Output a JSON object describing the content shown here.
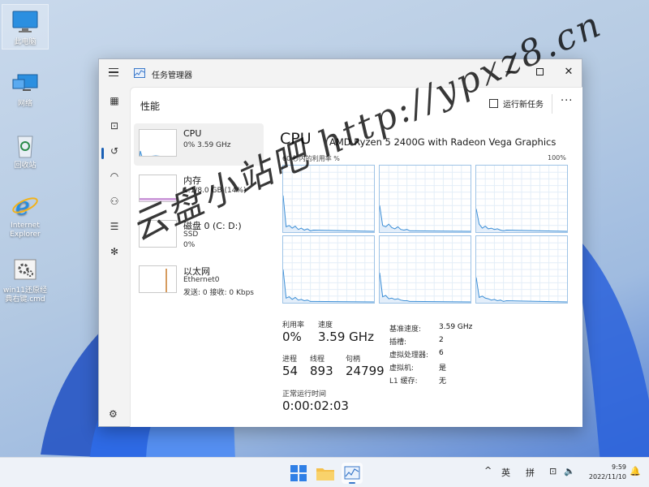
{
  "desktop": {
    "icons": [
      {
        "label": "此电脑"
      },
      {
        "label": "网络"
      },
      {
        "label": "回收站"
      },
      {
        "label": "Internet Explorer"
      },
      {
        "label": "win11还原经典右键.cmd"
      }
    ]
  },
  "window": {
    "title": "任务管理器",
    "page_title": "性能",
    "run_new_task": "运行新任务",
    "more": "···"
  },
  "resources": [
    {
      "name": "CPU",
      "line1": "0% 3.59 GHz",
      "line2": ""
    },
    {
      "name": "内存",
      "line1": "1.1/8.0 GB (14%)",
      "line2": ""
    },
    {
      "name": "磁盘 0 (C: D:)",
      "line1": "SSD",
      "line2": "0%"
    },
    {
      "name": "以太网",
      "line1": "Ethernet0",
      "line2": "发送: 0 接收: 0 Kbps"
    }
  ],
  "cpu": {
    "title": "CPU",
    "model": "AMD Ryzen 5 2400G with Radeon Vega Graphics",
    "graph_label": "60 秒内的利用率 %",
    "graph_max": "100%",
    "stats": {
      "utilization_label": "利用率",
      "utilization": "0%",
      "speed_label": "速度",
      "speed": "3.59 GHz",
      "processes_label": "进程",
      "processes": "54",
      "threads_label": "线程",
      "threads": "893",
      "handles_label": "句柄",
      "handles": "24799",
      "uptime_label": "正常运行时间",
      "uptime": "0:00:02:03"
    },
    "specs": [
      {
        "k": "基准速度:",
        "v": "3.59 GHz"
      },
      {
        "k": "插槽:",
        "v": "2"
      },
      {
        "k": "虚拟处理器:",
        "v": "6"
      },
      {
        "k": "虚拟机:",
        "v": "是"
      },
      {
        "k": "L1 缓存:",
        "v": "无"
      }
    ],
    "core_usage_pct": [
      [
        55,
        8,
        10,
        6,
        9,
        4,
        6,
        3,
        5,
        2,
        3
      ],
      [
        40,
        10,
        8,
        12,
        7,
        5,
        8,
        4,
        3,
        4,
        2
      ],
      [
        35,
        12,
        6,
        9,
        5,
        6,
        4,
        5,
        3,
        2,
        3
      ],
      [
        50,
        7,
        9,
        5,
        8,
        4,
        5,
        3,
        4,
        2,
        2
      ],
      [
        45,
        9,
        11,
        6,
        7,
        5,
        6,
        4,
        3,
        3,
        2
      ],
      [
        38,
        8,
        10,
        7,
        6,
        4,
        5,
        3,
        4,
        2,
        3
      ]
    ]
  },
  "watermark": "云盘小站吧 http://ypxz8.cn",
  "taskbar": {
    "ime": "英",
    "pinyin": "拼",
    "time": "9:59",
    "date": "2022/11/10"
  },
  "colors": {
    "accent": "#1a5fb4",
    "cpu_graph": "#3d8fd6",
    "memory_graph": "#9b3ab3",
    "disk_graph": "#4c9a2a",
    "net_graph": "#c87b2a"
  }
}
